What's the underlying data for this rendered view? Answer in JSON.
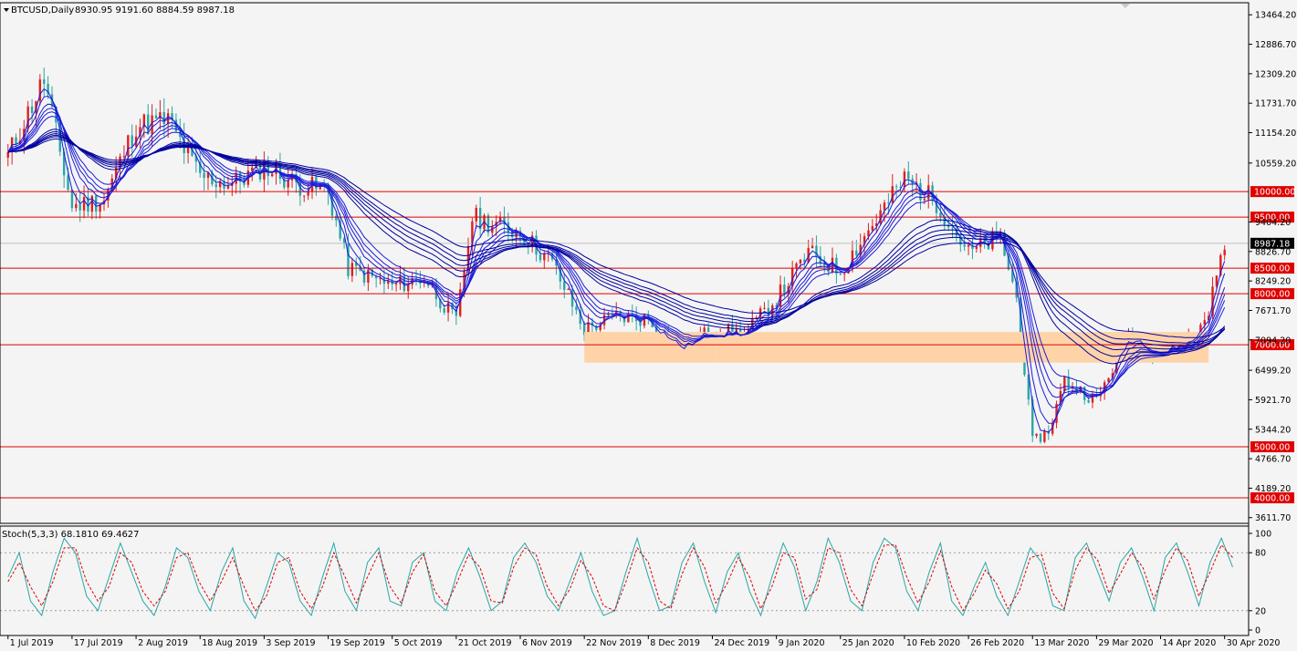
{
  "symbol_info": "BTCUSD,Daily",
  "ohlc_info": "8930.95 9191.60 8884.59 8987.18",
  "stoch_info": "Stoch(5,3,3) 68.1810 69.4627",
  "colors": {
    "background": "#f4f4f4",
    "bull_candle": "#e02020",
    "bear_candle": "#2aa6a6",
    "ma_ribbon": "#0000a0",
    "level_line": "#e00000",
    "support_zone": "#ffd3a8",
    "stoch_main": "#2aa6a6",
    "stoch_signal": "#e00000",
    "current_price": "#000000"
  },
  "chart_data": [
    {
      "type": "candlestick",
      "title": "BTCUSD,Daily",
      "ylim": [
        3500,
        13700
      ],
      "y_ticks": [
        "13464.20",
        "12886.70",
        "12309.20",
        "11731.70",
        "11154.20",
        "10559.20",
        "9404.20",
        "8826.70",
        "8249.20",
        "7671.70",
        "7094.20",
        "6499.20",
        "5921.70",
        "5344.20",
        "4766.70",
        "4189.20",
        "3611.70"
      ],
      "current_price": "8987.18",
      "horizontal_levels": [
        "10000.00",
        "9500.00",
        "8500.00",
        "8000.00",
        "7000.00",
        "5000.00",
        "4000.00"
      ],
      "support_zone": {
        "low": 6650,
        "high": 7250
      },
      "x_ticks": [
        "1 Jul 2019",
        "17 Jul 2019",
        "2 Aug 2019",
        "18 Aug 2019",
        "3 Sep 2019",
        "19 Sep 2019",
        "5 Oct 2019",
        "21 Oct 2019",
        "6 Nov 2019",
        "22 Nov 2019",
        "8 Dec 2019",
        "24 Dec 2019",
        "9 Jan 2020",
        "25 Jan 2020",
        "10 Feb 2020",
        "26 Feb 2020",
        "13 Mar 2020",
        "29 Mar 2020",
        "14 Apr 2020",
        "30 Apr 2020"
      ],
      "close_path": [
        [
          "1 Jul 2019",
          10700
        ],
        [
          "10 Jul 2019",
          12200
        ],
        [
          "17 Jul 2019",
          9700
        ],
        [
          "25 Jul 2019",
          9850
        ],
        [
          "2 Aug 2019",
          11300
        ],
        [
          "10 Aug 2019",
          11400
        ],
        [
          "18 Aug 2019",
          10300
        ],
        [
          "26 Aug 2019",
          10150
        ],
        [
          "3 Sep 2019",
          10500
        ],
        [
          "11 Sep 2019",
          10150
        ],
        [
          "19 Sep 2019",
          10000
        ],
        [
          "24 Sep 2019",
          8500
        ],
        [
          "5 Oct 2019",
          8150
        ],
        [
          "13 Oct 2019",
          8300
        ],
        [
          "21 Oct 2019",
          7450
        ],
        [
          "25 Oct 2019",
          9500
        ],
        [
          "6 Nov 2019",
          9200
        ],
        [
          "14 Nov 2019",
          8600
        ],
        [
          "22 Nov 2019",
          7300
        ],
        [
          "30 Nov 2019",
          7550
        ],
        [
          "8 Dec 2019",
          7500
        ],
        [
          "16 Dec 2019",
          6900
        ],
        [
          "24 Dec 2019",
          7300
        ],
        [
          "1 Jan 2020",
          7200
        ],
        [
          "9 Jan 2020",
          7900
        ],
        [
          "17 Jan 2020",
          8800
        ],
        [
          "25 Jan 2020",
          8450
        ],
        [
          "2 Feb 2020",
          9350
        ],
        [
          "10 Feb 2020",
          10250
        ],
        [
          "18 Feb 2020",
          9800
        ],
        [
          "26 Feb 2020",
          8800
        ],
        [
          "5 Mar 2020",
          9100
        ],
        [
          "9 Mar 2020",
          7900
        ],
        [
          "13 Mar 2020",
          5100
        ],
        [
          "17 Mar 2020",
          5300
        ],
        [
          "21 Mar 2020",
          6300
        ],
        [
          "29 Mar 2020",
          5900
        ],
        [
          "6 Apr 2020",
          7200
        ],
        [
          "14 Apr 2020",
          6850
        ],
        [
          "22 Apr 2020",
          7100
        ],
        [
          "26 Apr 2020",
          7700
        ],
        [
          "30 Apr 2020",
          8987
        ]
      ]
    },
    {
      "type": "line",
      "title": "Stoch(5,3,3) 68.1810 69.4627",
      "ylim": [
        0,
        100
      ],
      "y_ticks": [
        "100",
        "80",
        "20",
        "0"
      ],
      "levels": [
        80,
        20
      ],
      "series": [
        {
          "name": "68.1810",
          "values": [
            55,
            80,
            30,
            15,
            60,
            95,
            80,
            35,
            20,
            55,
            90,
            60,
            30,
            15,
            45,
            85,
            75,
            40,
            20,
            60,
            85,
            30,
            12,
            45,
            80,
            70,
            30,
            15,
            55,
            90,
            40,
            20,
            70,
            85,
            30,
            25,
            70,
            80,
            30,
            20,
            60,
            85,
            55,
            20,
            30,
            75,
            90,
            70,
            35,
            20,
            50,
            80,
            40,
            15,
            20,
            60,
            95,
            55,
            20,
            25,
            70,
            90,
            50,
            18,
            60,
            80,
            40,
            15,
            55,
            90,
            65,
            20,
            50,
            95,
            70,
            30,
            20,
            70,
            95,
            85,
            40,
            20,
            60,
            90,
            30,
            15,
            45,
            70,
            35,
            15,
            50,
            85,
            70,
            25,
            20,
            75,
            90,
            60,
            30,
            70,
            85,
            55,
            20,
            75,
            90,
            60,
            25,
            70,
            95,
            65
          ]
        },
        {
          "name": "69.4627",
          "values": [
            50,
            70,
            45,
            25,
            50,
            85,
            85,
            50,
            30,
            45,
            80,
            70,
            40,
            25,
            40,
            75,
            80,
            50,
            30,
            50,
            75,
            45,
            20,
            35,
            70,
            75,
            40,
            22,
            45,
            80,
            55,
            28,
            55,
            80,
            45,
            28,
            60,
            78,
            40,
            25,
            50,
            78,
            65,
            30,
            28,
            65,
            85,
            78,
            45,
            25,
            42,
            72,
            55,
            25,
            20,
            50,
            85,
            70,
            30,
            22,
            58,
            85,
            65,
            28,
            48,
            75,
            55,
            22,
            45,
            80,
            75,
            32,
            42,
            85,
            80,
            42,
            25,
            58,
            88,
            88,
            55,
            28,
            50,
            82,
            45,
            20,
            38,
            62,
            48,
            22,
            40,
            75,
            78,
            38,
            22,
            62,
            85,
            72,
            38,
            58,
            80,
            65,
            32,
            62,
            85,
            72,
            35,
            60,
            88,
            75
          ]
        }
      ]
    }
  ]
}
